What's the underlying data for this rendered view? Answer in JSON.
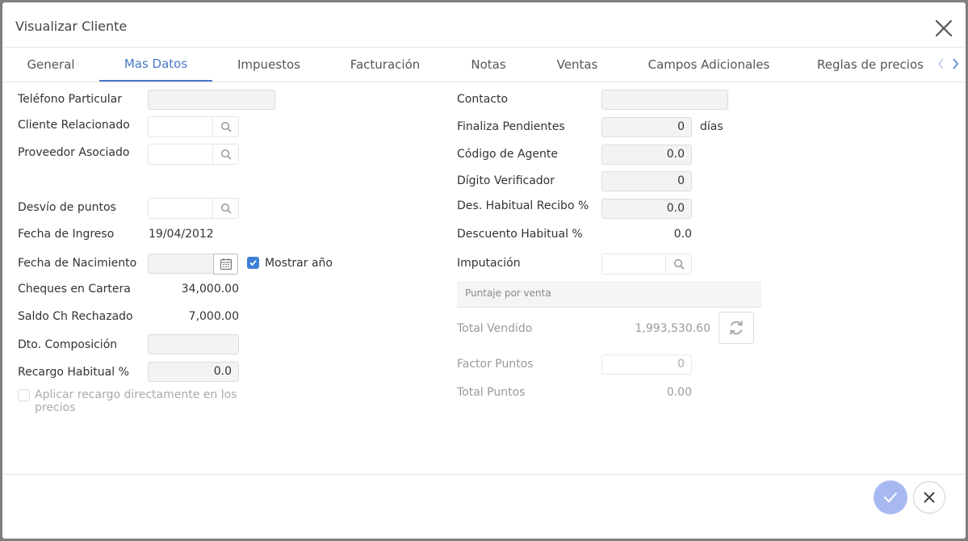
{
  "modal": {
    "title": "Visualizar Cliente"
  },
  "tabs": [
    {
      "label": "General"
    },
    {
      "label": "Mas Datos"
    },
    {
      "label": "Impuestos"
    },
    {
      "label": "Facturación"
    },
    {
      "label": "Notas"
    },
    {
      "label": "Ventas"
    },
    {
      "label": "Campos Adicionales"
    },
    {
      "label": "Reglas de precios"
    }
  ],
  "active_tab": "Mas Datos",
  "left": {
    "telefono_particular": {
      "label": "Teléfono Particular",
      "value": ""
    },
    "cliente_relacionado": {
      "label": "Cliente Relacionado",
      "value": ""
    },
    "proveedor_asociado": {
      "label": "Proveedor Asociado",
      "value": ""
    },
    "desvio_puntos": {
      "label": "Desvío de puntos",
      "value": ""
    },
    "fecha_ingreso": {
      "label": "Fecha de Ingreso",
      "value": "19/04/2012"
    },
    "fecha_nacimiento": {
      "label": "Fecha de Nacimiento",
      "value": ""
    },
    "mostrar_anio": {
      "label": "Mostrar año",
      "checked": true
    },
    "cheques_cartera": {
      "label": "Cheques en Cartera",
      "value": "34,000.00"
    },
    "saldo_rechazado": {
      "label": "Saldo Ch Rechazado",
      "value": "7,000.00"
    },
    "dto_composicion": {
      "label": "Dto. Composición",
      "value": ""
    },
    "recargo_habitual": {
      "label": "Recargo Habitual %",
      "value": "0.0"
    },
    "aplicar_recargo": {
      "label": "Aplicar recargo directamente en los precios",
      "checked": false
    }
  },
  "right": {
    "contacto": {
      "label": "Contacto",
      "value": ""
    },
    "finaliza_pendientes": {
      "label": "Finaliza Pendientes",
      "value": "0",
      "unit": "días"
    },
    "codigo_agente": {
      "label": "Código de Agente",
      "value": "0.0"
    },
    "digito_verificador": {
      "label": "Dígito Verificador",
      "value": "0"
    },
    "des_habitual_recibo": {
      "label": "Des. Habitual Recibo %",
      "value": "0.0"
    },
    "descuento_habitual": {
      "label": "Descuento Habitual %",
      "value": "0.0"
    },
    "imputacion": {
      "label": "Imputación",
      "value": ""
    }
  },
  "puntaje": {
    "section_title": "Puntaje por venta",
    "total_vendido": {
      "label": "Total Vendido",
      "value": "1,993,530.60"
    },
    "factor_puntos": {
      "label": "Factor Puntos",
      "value": "0"
    },
    "total_puntos": {
      "label": "Total Puntos",
      "value": "0.00"
    }
  },
  "colors": {
    "accent": "#4a78c8",
    "checkbox": "#3d7fd6",
    "confirm": "#a8b9f2"
  },
  "icons": {
    "close": "close-icon",
    "search": "search-icon",
    "calendar": "calendar-icon",
    "refresh": "refresh-icon",
    "confirm": "check-icon",
    "cancel": "close-icon",
    "tab_prev": "chevron-left-icon",
    "tab_next": "chevron-right-icon"
  }
}
